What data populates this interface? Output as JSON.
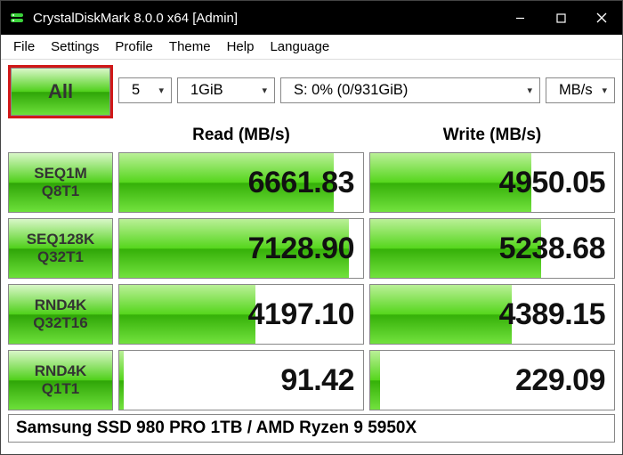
{
  "window": {
    "title": "CrystalDiskMark 8.0.0 x64 [Admin]"
  },
  "menu": {
    "file": "File",
    "settings": "Settings",
    "profile": "Profile",
    "theme": "Theme",
    "help": "Help",
    "language": "Language"
  },
  "controls": {
    "all_label": "All",
    "runs": "5",
    "size": "1GiB",
    "drive": "S: 0% (0/931GiB)",
    "unit": "MB/s"
  },
  "headers": {
    "read": "Read (MB/s)",
    "write": "Write (MB/s)"
  },
  "tests": [
    {
      "l1": "SEQ1M",
      "l2": "Q8T1",
      "read": "6661.83",
      "rbar": 88,
      "write": "4950.05",
      "wbar": 66
    },
    {
      "l1": "SEQ128K",
      "l2": "Q32T1",
      "read": "7128.90",
      "rbar": 94,
      "write": "5238.68",
      "wbar": 70
    },
    {
      "l1": "RND4K",
      "l2": "Q32T16",
      "read": "4197.10",
      "rbar": 56,
      "write": "4389.15",
      "wbar": 58
    },
    {
      "l1": "RND4K",
      "l2": "Q1T1",
      "read": "91.42",
      "rbar": 2,
      "write": "229.09",
      "wbar": 4
    }
  ],
  "footer": {
    "text": "Samsung SSD 980 PRO 1TB / AMD Ryzen 9 5950X"
  }
}
